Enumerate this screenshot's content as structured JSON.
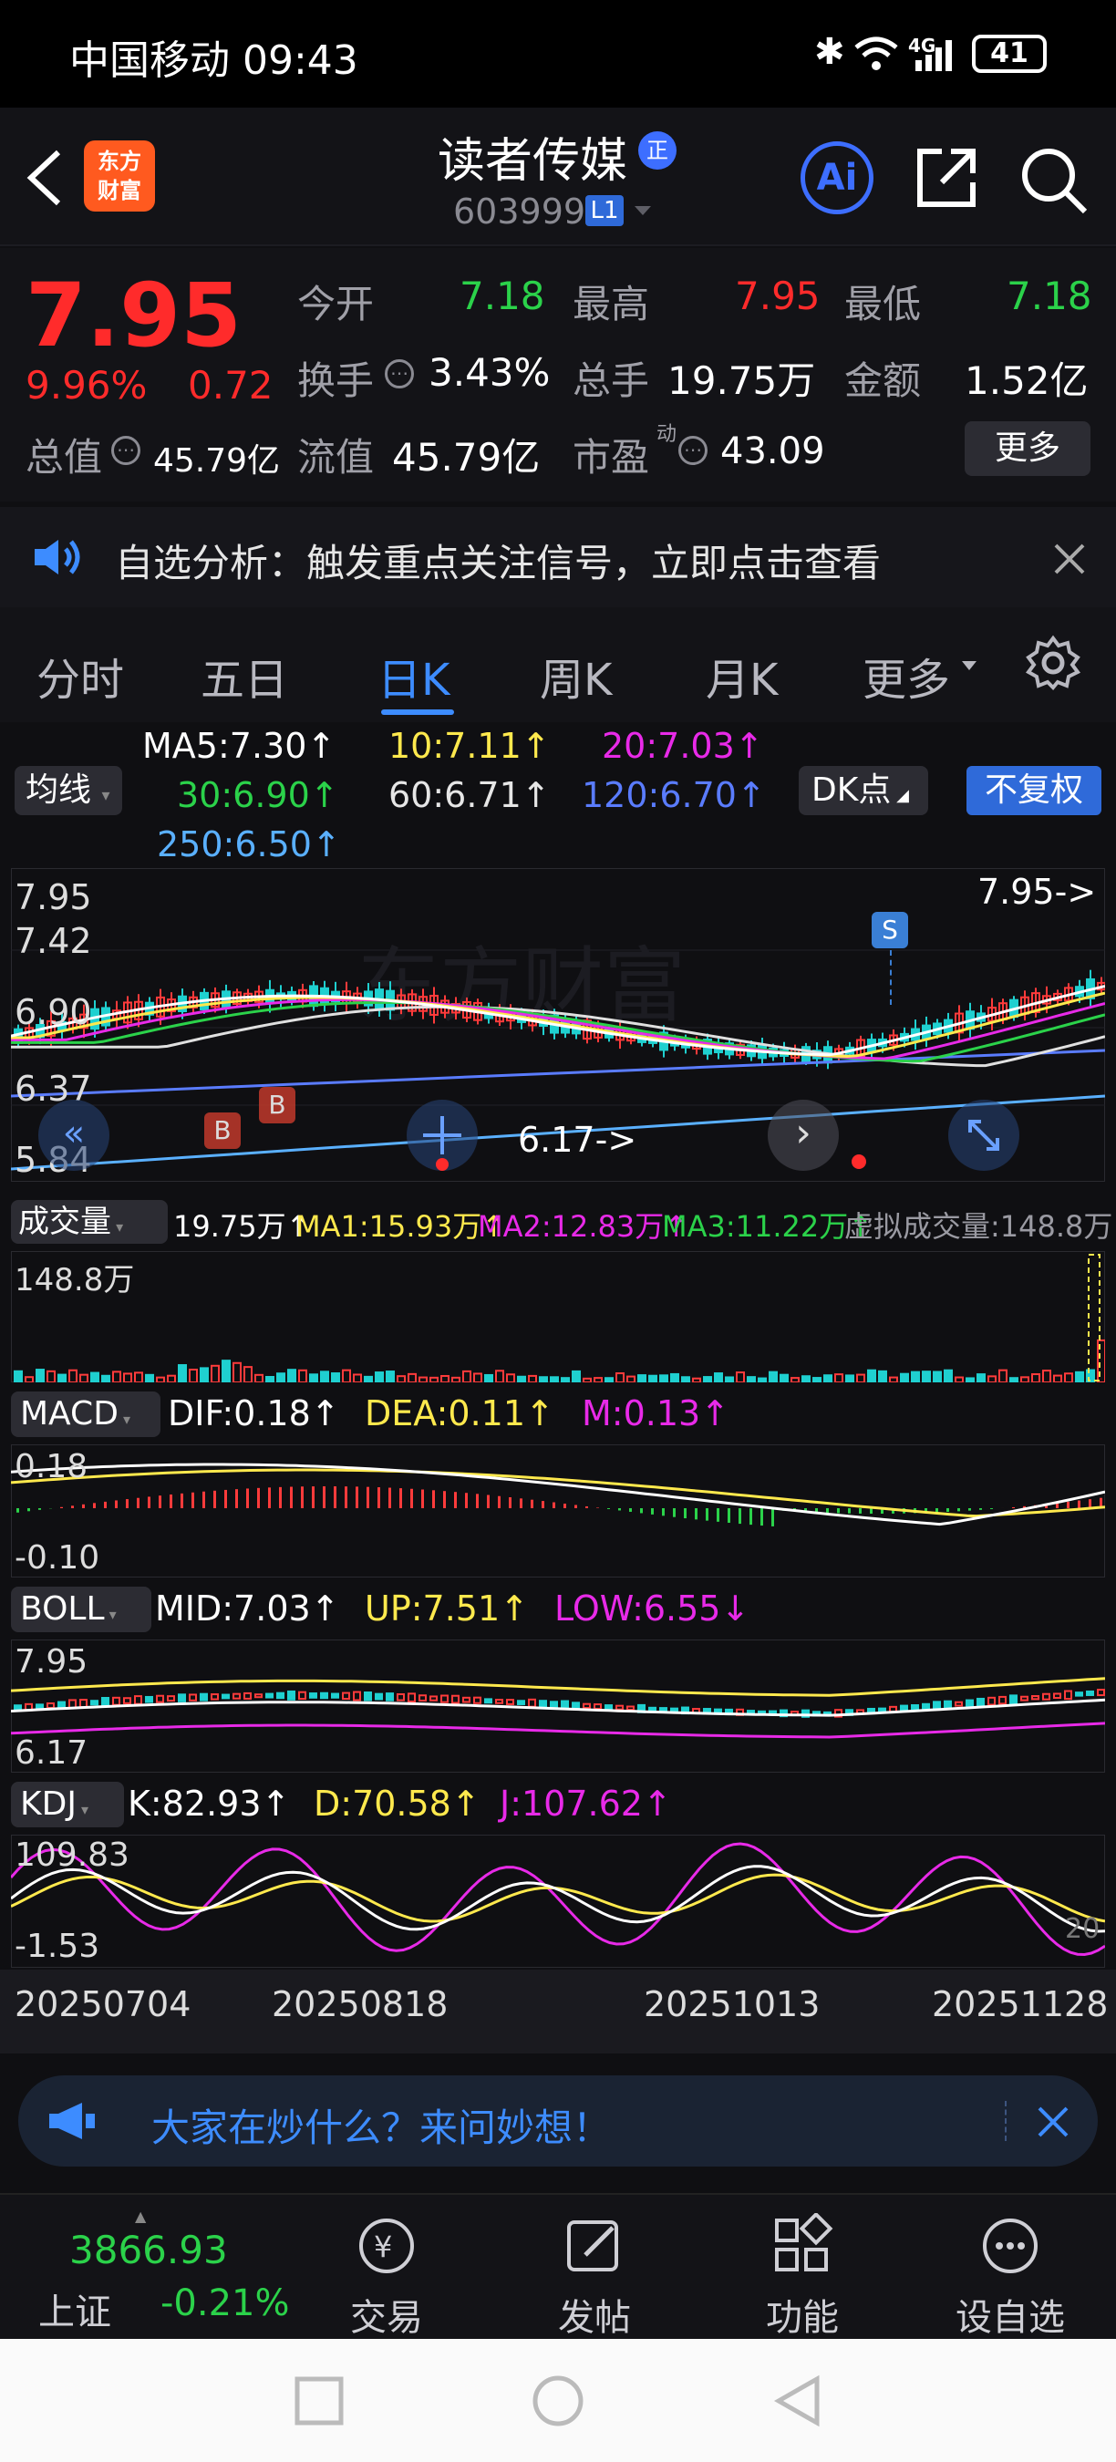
{
  "status_bar": {
    "carrier_time": "中国移动 09:43",
    "network": "4G",
    "battery": "41"
  },
  "header": {
    "logo_line1": "东方",
    "logo_line2": "财富",
    "stock_name": "读者传媒",
    "tag": "正",
    "stock_code": "603999",
    "level": "L1",
    "ai_label": "Ai"
  },
  "quote": {
    "price": "7.95",
    "change_pct": "9.96%",
    "change": "0.72",
    "open_label": "今开",
    "open": "7.18",
    "high_label": "最高",
    "high": "7.95",
    "low_label": "最低",
    "low": "7.18",
    "turnover_label": "换手",
    "turnover": "3.43%",
    "volume_label": "总手",
    "volume": "19.75万",
    "amount_label": "金额",
    "amount": "1.52亿",
    "mktcap_label": "总值",
    "mktcap": "45.79亿",
    "float_label": "流值",
    "float": "45.79亿",
    "pe_label": "市盈",
    "pe_sup": "动",
    "pe": "43.09",
    "more_label": "更多"
  },
  "notice": {
    "text": "自选分析：触发重点关注信号，立即点击查看"
  },
  "tabs": [
    "分时",
    "五日",
    "日K",
    "周K",
    "月K",
    "更多"
  ],
  "active_tab": "日K",
  "ma_legend": {
    "button": "均线",
    "ma5": "MA5:7.30↑",
    "ma10": "10:7.11↑",
    "ma20": "20:7.03↑",
    "ma30": "30:6.90↑",
    "ma60": "60:6.71↑",
    "ma120": "120:6.70↑",
    "ma250": "250:6.50↑",
    "dk_button": "DK点",
    "adjust_button": "不复权"
  },
  "kline": {
    "y_top": "7.95",
    "y_2": "7.42",
    "y_3": "6.90",
    "y_4": "6.37",
    "y_bottom": "5.84",
    "high_marker": "7.95->",
    "low_marker": "6.17->",
    "watermark": "东方财富",
    "s_marker": "S",
    "b_marker": "B"
  },
  "volume": {
    "button": "成交量",
    "value": "19.75万↑",
    "ma1": "MA1:15.93万↑",
    "ma2": "MA2:12.83万↑",
    "ma3": "MA3:11.22万↑",
    "virtual": "虚拟成交量:148.8万",
    "y_top": "148.8万"
  },
  "macd": {
    "button": "MACD",
    "dif": "DIF:0.18↑",
    "dea": "DEA:0.11↑",
    "m": "M:0.13↑",
    "y_top": "0.18",
    "y_bottom": "-0.10"
  },
  "boll": {
    "button": "BOLL",
    "mid": "MID:7.03↑",
    "up": "UP:7.51↑",
    "low": "LOW:6.55↓",
    "y_top": "7.95",
    "y_bottom": "6.17"
  },
  "kdj": {
    "button": "KDJ",
    "k": "K:82.93↑",
    "d": "D:70.58↑",
    "j": "J:107.62↑",
    "y_top": "109.83",
    "y_bottom": "-1.53",
    "right_label": "20"
  },
  "dates": [
    "20250704",
    "20250818",
    "20251013",
    "20251128"
  ],
  "ask_banner": {
    "text": "大家在炒什么？来问妙想！"
  },
  "bottom_nav": {
    "index_value": "3866.93",
    "index_name": "上证",
    "index_change": "-0.21%",
    "items": [
      "交易",
      "发帖",
      "功能",
      "设自选"
    ]
  }
}
